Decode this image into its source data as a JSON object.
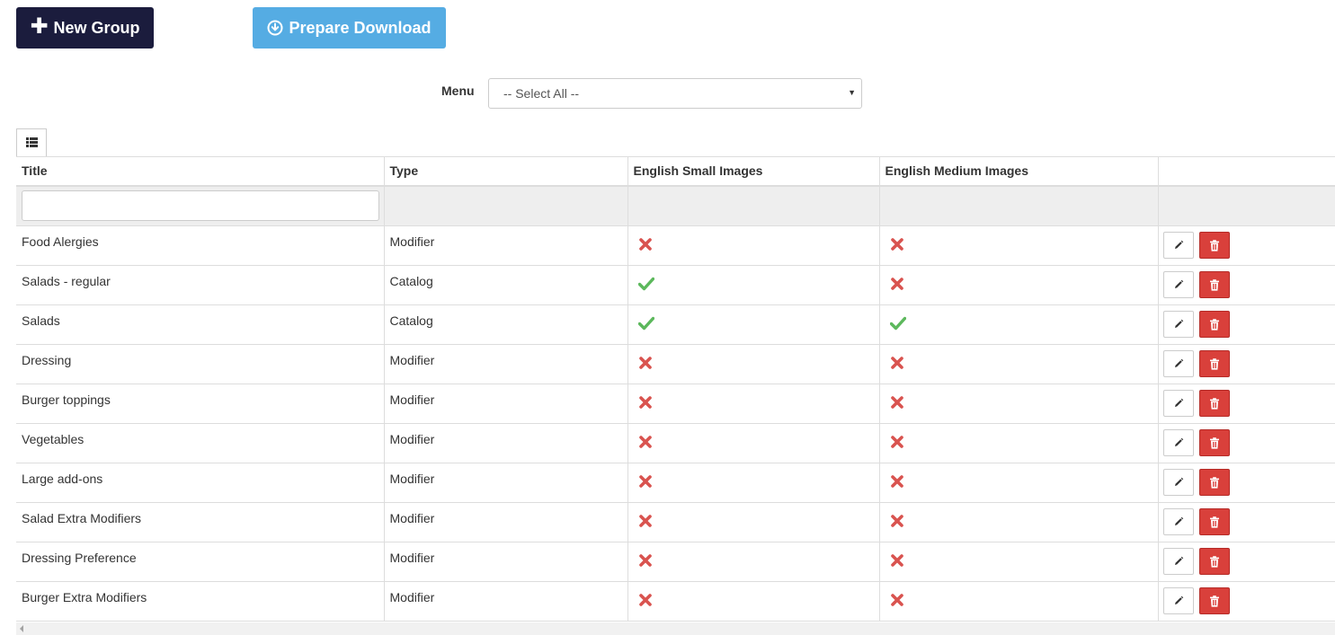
{
  "toolbar": {
    "new_group_label": "New Group",
    "prepare_download_label": "Prepare Download"
  },
  "filter": {
    "menu_label": "Menu",
    "menu_selected": "-- Select All --"
  },
  "table": {
    "columns": [
      "Title",
      "Type",
      "English Small Images",
      "English Medium Images",
      ""
    ],
    "title_filter_value": "",
    "rows": [
      {
        "title": "Food Alergies",
        "type": "Modifier",
        "small_images": false,
        "medium_images": false
      },
      {
        "title": "Salads - regular",
        "type": "Catalog",
        "small_images": true,
        "medium_images": false
      },
      {
        "title": "Salads",
        "type": "Catalog",
        "small_images": true,
        "medium_images": true
      },
      {
        "title": "Dressing",
        "type": "Modifier",
        "small_images": false,
        "medium_images": false
      },
      {
        "title": "Burger toppings",
        "type": "Modifier",
        "small_images": false,
        "medium_images": false
      },
      {
        "title": "Vegetables",
        "type": "Modifier",
        "small_images": false,
        "medium_images": false
      },
      {
        "title": "Large add-ons",
        "type": "Modifier",
        "small_images": false,
        "medium_images": false
      },
      {
        "title": "Salad Extra Modifiers",
        "type": "Modifier",
        "small_images": false,
        "medium_images": false
      },
      {
        "title": "Dressing Preference",
        "type": "Modifier",
        "small_images": false,
        "medium_images": false
      },
      {
        "title": "Burger Extra Modifiers",
        "type": "Modifier",
        "small_images": false,
        "medium_images": false
      }
    ]
  },
  "icons": {
    "check": "check-icon",
    "cross": "cross-icon",
    "edit": "pencil-icon",
    "delete": "trash-icon",
    "columns": "list-icon",
    "download": "download-circle-icon",
    "add": "plus-icon"
  },
  "colors": {
    "new_group_bg": "#1b1c3d",
    "prepare_download_bg": "#55ace3",
    "check": "#5cb85c",
    "cross": "#d9534f",
    "delete_bg": "#d9403b"
  }
}
